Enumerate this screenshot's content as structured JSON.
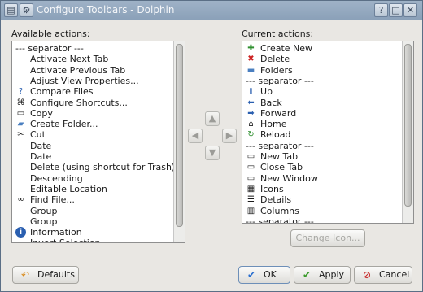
{
  "window": {
    "title": "Configure Toolbars - Dolphin",
    "help_label": "?",
    "min_label": "□",
    "close_label": "✕"
  },
  "available": {
    "label": "Available actions:",
    "items": [
      {
        "label": "--- separator ---",
        "icon": ""
      },
      {
        "label": "Activate Next Tab",
        "icon": ""
      },
      {
        "label": "Activate Previous Tab",
        "icon": ""
      },
      {
        "label": "Adjust View Properties...",
        "icon": ""
      },
      {
        "label": "Compare Files",
        "icon": "?"
      },
      {
        "label": "Configure Shortcuts...",
        "icon": "⌘"
      },
      {
        "label": "Copy",
        "icon": "▭"
      },
      {
        "label": "Create Folder...",
        "icon": "▰"
      },
      {
        "label": "Cut",
        "icon": "✂"
      },
      {
        "label": "Date",
        "icon": ""
      },
      {
        "label": "Date",
        "icon": ""
      },
      {
        "label": "Delete (using shortcut for Trash)",
        "icon": ""
      },
      {
        "label": "Descending",
        "icon": ""
      },
      {
        "label": "Editable Location",
        "icon": ""
      },
      {
        "label": "Find File...",
        "icon": "∞"
      },
      {
        "label": "Group",
        "icon": ""
      },
      {
        "label": "Group",
        "icon": ""
      },
      {
        "label": "Information",
        "icon": "i"
      },
      {
        "label": "Invert Selection",
        "icon": ""
      }
    ]
  },
  "current": {
    "label": "Current actions:",
    "items": [
      {
        "label": "Create New",
        "icon": "✚"
      },
      {
        "label": "Delete",
        "icon": "✖"
      },
      {
        "label": "Folders",
        "icon": "▬"
      },
      {
        "label": "--- separator ---",
        "icon": ""
      },
      {
        "label": "Up",
        "icon": "⬆"
      },
      {
        "label": "Back",
        "icon": "⬅"
      },
      {
        "label": "Forward",
        "icon": "➡"
      },
      {
        "label": "Home",
        "icon": "⌂"
      },
      {
        "label": "Reload",
        "icon": "↻"
      },
      {
        "label": "--- separator ---",
        "icon": ""
      },
      {
        "label": "New Tab",
        "icon": "▭"
      },
      {
        "label": "Close Tab",
        "icon": "▭"
      },
      {
        "label": "New Window",
        "icon": "▭"
      },
      {
        "label": "Icons",
        "icon": "▦"
      },
      {
        "label": "Details",
        "icon": "☰"
      },
      {
        "label": "Columns",
        "icon": "▥"
      },
      {
        "label": "--- separator ---",
        "icon": ""
      }
    ]
  },
  "arrows": {
    "up": "▲",
    "left": "◀",
    "right": "▶",
    "down": "▼"
  },
  "buttons": {
    "change_icon": "Change Icon...",
    "defaults": "Defaults",
    "ok": "OK",
    "apply": "Apply",
    "cancel": "Cancel"
  },
  "colors": {
    "titlebar": "#8fa4bb",
    "ok_check": "#2a6fd0",
    "apply_check": "#3a9a2a",
    "cancel_red": "#c62020"
  }
}
